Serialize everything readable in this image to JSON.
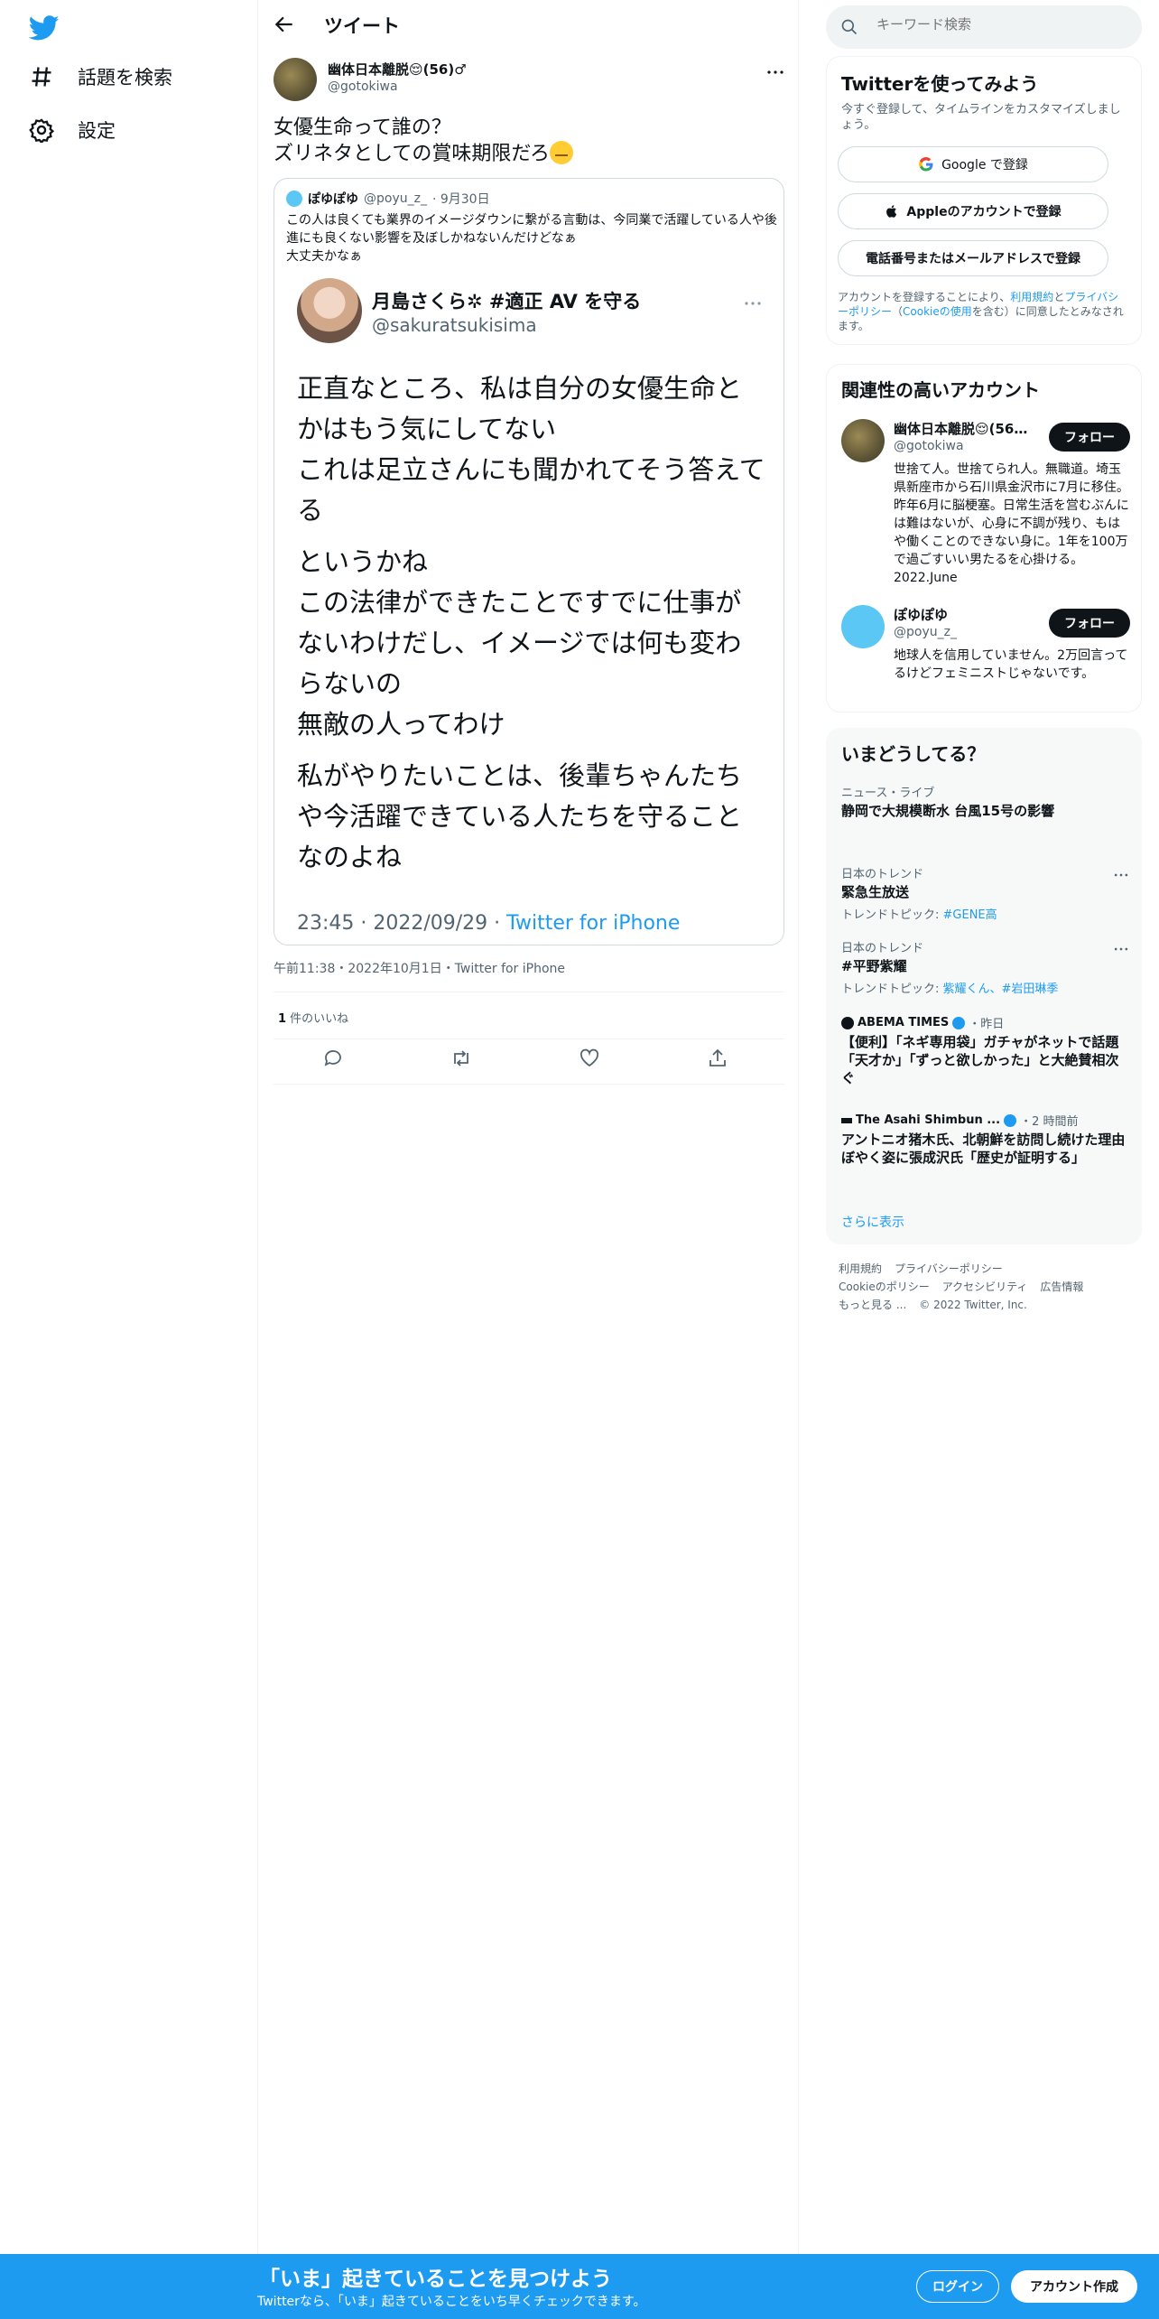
{
  "nav": {
    "logo": "twitter-bird-icon",
    "explore_label": "話題を検索",
    "settings_label": "設定"
  },
  "header": {
    "title": "ツイート"
  },
  "tweet": {
    "author_name": "幽体日本離脱😌(56)♂",
    "author_handle": "@gotokiwa",
    "text": "女優生命って誰の？\nズリネタとしての賞味期限だろ",
    "emoji": "face-emoji",
    "timestamp": "午前11:38・2022年10月1日・Twitter for iPhone",
    "likes_count": "1",
    "likes_label": " 件のいいね"
  },
  "quote": {
    "name": "ぽゆぽゆ",
    "handle": "@poyu_z_",
    "date": "· 9月30日",
    "text": "この人は良くても業界のイメージダウンに繋がる言動は、今同業で活躍している人や後進にも良くない影響を及ぼしかねないんだけどなぁ\n大丈夫かなぁ",
    "image": {
      "name": "月島さくら✲ #適正 AV を守る",
      "handle": "@sakuratsukisima",
      "paragraphs": [
        "正直なところ、私は自分の女優生命とかはもう気にしてない\nこれは足立さんにも聞かれてそう答えてる",
        "というかね\nこの法律ができたことですでに仕事がないわけだし、イメージでは何も変わらないの\n無敵の人ってわけ",
        "私がやりたいことは、後輩ちゃんたちや今活躍できている人たちを守ることなのよね"
      ],
      "footer_time": "23:45 · 2022/09/29 · ",
      "footer_source": "Twitter for iPhone"
    }
  },
  "search": {
    "placeholder": "キーワード検索"
  },
  "signup": {
    "title": "Twitterを使ってみよう",
    "subtitle": "今すぐ登録して、タイムラインをカスタマイズしましょう。",
    "google_label": "Google で登録",
    "apple_label": "Appleのアカウントで登録",
    "phone_label": "電話番号またはメールアドレスで登録",
    "legal_prefix": "アカウントを登録することにより、",
    "legal_terms": "利用規約",
    "legal_and": "と",
    "legal_privacy": "プライバシーポリシー",
    "legal_cookie_open": "（",
    "legal_cookie": "Cookieの使用",
    "legal_suffix": "を含む）に同意したとみなされます。"
  },
  "related": {
    "title": "関連性の高いアカウント",
    "follow_label": "フォロー",
    "accounts": [
      {
        "name": "幽体日本離脱😌(56)...",
        "handle": "@gotokiwa",
        "bio": "世捨て人。世捨てられ人。無職道。埼玉県新座市から石川県金沢市に7月に移住。昨年6月に脳梗塞。日常生活を営むぶんには難はないが、心身に不調が残り、もはや働くことのできない身に。1年を100万で過ごすいい男たるを心掛ける。2022.June"
      },
      {
        "name": "ぽゆぽゆ",
        "handle": "@poyu_z_",
        "bio": "地球人を信用していません。2万回言ってるけどフェミニストじゃないです。"
      }
    ]
  },
  "trends": {
    "title": "いまどうしてる？",
    "items": [
      {
        "context": "ニュース・ライブ",
        "title": "静岡で大規模断水 台風15号の影響"
      },
      {
        "context": "日本のトレンド",
        "title": "緊急生放送",
        "sub_prefix": "トレンドトピック: ",
        "sub_tags": "#GENE高"
      },
      {
        "context": "日本のトレンド",
        "title": "#平野紫耀",
        "sub_prefix": "トレンドトピック: ",
        "sub_tags": "紫耀くん、#岩田琳季"
      },
      {
        "source": "ABEMA TIMES",
        "time": "・昨日",
        "title": "【便利】「ネギ専用袋」ガチャがネットで話題　「天才か」「ずっと欲しかった」と大絶賛相次ぐ"
      },
      {
        "source": "The Asahi Shimbun ...",
        "time": "・2 時間前",
        "title": "アントニオ猪木氏、北朝鮮を訪問し続けた理由　ぼやく姿に張成沢氏「歴史が証明する」"
      }
    ],
    "show_more": "さらに表示"
  },
  "footer": {
    "links": [
      "利用規約",
      "プライバシーポリシー",
      "Cookieのポリシー",
      "アクセシビリティ",
      "広告情報",
      "もっと見る ...",
      "© 2022 Twitter, Inc."
    ]
  },
  "bottom": {
    "title": "「いま」起きていることを見つけよう",
    "subtitle": "Twitterなら、「いま」起きていることをいち早くチェックできます。",
    "login_label": "ログイン",
    "signup_label": "アカウント作成"
  },
  "colors": {
    "accent": "#1d9bf0",
    "text": "#0f1419",
    "muted": "#536471"
  }
}
